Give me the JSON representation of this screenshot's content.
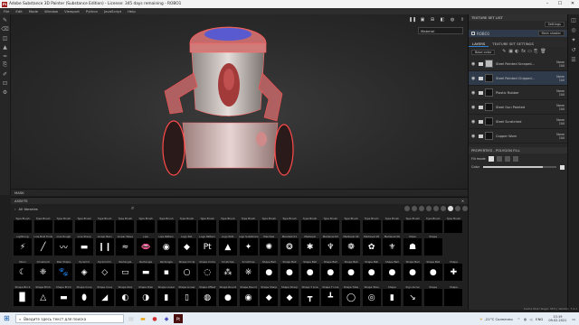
{
  "titlebar": {
    "logo": "Pt",
    "title": "Adobe Substance 3D Painter (Substance Edition) - License: 345 days remaining - ROBO1",
    "minimize": "–",
    "maximize": "☐",
    "close": "✕"
  },
  "menu": [
    "File",
    "Edit",
    "Mode",
    "Window",
    "Viewport",
    "Python",
    "JavaScript",
    "Help"
  ],
  "viewport": {
    "material_mode": "Material"
  },
  "mask_bar": {
    "label": "MASK"
  },
  "assets": {
    "header": "ASSETS",
    "library": "All libraries",
    "rows": [
      {
        "labels": [
          "Type Brush",
          "Type Brush",
          "Type Brush",
          "Type Brush",
          "Type Brush",
          "Type Brush",
          "Type Brush",
          "Type Brush",
          "Type Brush",
          "Type Brush",
          "Type Brush",
          "Type Brush",
          "Type Brush",
          "Type Brush",
          "Type Brush",
          "Type Brush",
          "Type Brush",
          "Type Brush",
          "Type Brush",
          "Type Brush",
          "Type Brush",
          "Type Brush"
        ],
        "glyphs": [
          "",
          "",
          "",
          "",
          "",
          "",
          "",
          "",
          "",
          "",
          "",
          "",
          "",
          "",
          "",
          "",
          "",
          "",
          "",
          "",
          "",
          ""
        ]
      },
      {
        "labels": [
          "Lightning",
          "Line Bold Ends",
          "Line Rough",
          "Line Sharp",
          "Linear Bars",
          "Linear Wave",
          "Lips",
          "Lips Pattern",
          "Logo Pat.",
          "Logo Pattern",
          "Logo Patt.",
          "Logo Substance",
          "Mandala",
          "Mandala 01",
          "Medieval",
          "Medieval 03",
          "Medieval 04",
          "Medieval 05",
          "Medieval 06",
          "Mesa",
          "Shape"
        ],
        "glyphs": [
          "⚡",
          "╱",
          "〰",
          "▬",
          "❙❙",
          "≈",
          "👄",
          "◉",
          "◆",
          "Pt",
          "▲",
          "✦",
          "✺",
          "❂",
          "✱",
          "♆",
          "❁",
          "✿",
          "⚜",
          "☗",
          ""
        ]
      },
      {
        "labels": [
          "Moon",
          "Ornament",
          "Paw Shape",
          "Pyramid",
          "Pyramid D.",
          "Rectangle",
          "Rectangle",
          "Rectangle",
          "Shape Circle",
          "Shape Circle",
          "Scratches",
          "Scratches",
          "Shape Bell",
          "Shape Bell",
          "Shape Bell",
          "Shape Bell",
          "Shape Bell",
          "Shape Bell",
          "Shape Bell",
          "Shape Bell",
          "Shape Bell",
          "Shape"
        ],
        "glyphs": [
          "☾",
          "❈",
          "🐾",
          "◈",
          "◇",
          "▭",
          "▬",
          "▪",
          "○",
          "◌",
          "⁂",
          "※",
          "●",
          "●",
          "●",
          "●",
          "●",
          "●",
          "●",
          "●",
          "●",
          "✚"
        ]
      },
      {
        "labels": [
          "Shape Brick",
          "Shape Brick",
          "Shape Brick",
          "Shape Cone",
          "Shape Cone",
          "Shape Disk",
          "Shape Disk",
          "Shape Linear",
          "Shape Linear",
          "Shape Offset",
          "Shape Round",
          "Shape Round",
          "Shape Sharp",
          "Shape Sharp",
          "Shape T Line",
          "Shape T Line",
          "Shape Tube",
          "Shape Tube",
          "Shape",
          "Sign Arrow",
          "Shape",
          "Shape"
        ],
        "glyphs": [
          "▉",
          "△",
          "▬",
          "⬮",
          "◢",
          "◐",
          "◑",
          "▮",
          "▯",
          "◍",
          "●",
          "◉",
          "◆",
          "◆",
          "┳",
          "┻",
          "◯",
          "◎",
          "▮",
          "↘",
          "",
          ""
        ]
      }
    ]
  },
  "right_panel": {
    "texture_set_list": "TEXTURE SET LIST",
    "settings": "Settings",
    "texture_set": "ROBO1",
    "shader": "Main shader",
    "tabs": [
      "LAYERS",
      "TEXTURE SET SETTINGS"
    ],
    "blend_mode": "Base color",
    "layers": [
      {
        "name": "Steel Painted Scraped...",
        "mode": "Norm",
        "opacity": "100",
        "thumb": "w",
        "selected": false
      },
      {
        "name": "Steel Painted Chipped...",
        "mode": "Norm",
        "opacity": "100",
        "thumb": "d",
        "selected": true
      },
      {
        "name": "Plastic Rubber",
        "mode": "Norm",
        "opacity": "100",
        "thumb": "d",
        "selected": false
      },
      {
        "name": "Steel Gun Painted",
        "mode": "Norm",
        "opacity": "100",
        "thumb": "d",
        "selected": false
      },
      {
        "name": "Steel Scratched",
        "mode": "Norm",
        "opacity": "100",
        "thumb": "d",
        "selected": false
      },
      {
        "name": "Copper Worn",
        "mode": "Norm",
        "opacity": "100",
        "thumb": "d",
        "selected": false
      }
    ],
    "properties": "PROPERTIES - POLYGON FILL",
    "fill_mode": "Fill mode",
    "color": "Color",
    "color_value": 0.82
  },
  "cache": "Cache Disk Usage: 34% | Version: 7.4.1",
  "taskbar": {
    "search_placeholder": "Введите здесь текст для поиска",
    "weather": "-21°C Солнечно",
    "lang": "ENG",
    "time": "13:19",
    "date": "09.02.2021"
  }
}
